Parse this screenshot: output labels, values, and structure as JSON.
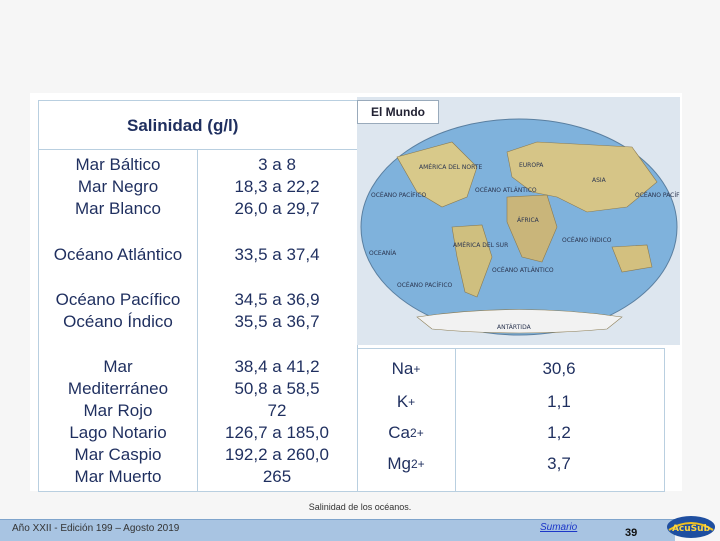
{
  "title": "Salinidad (g/l)",
  "map_title": "El Mundo",
  "map_labels": [
    "AMÉRICA DEL NORTE",
    "EUROPA",
    "ASIA",
    "OCÉANO ATLÁNTICO",
    "OCÉANO PACÍFICO",
    "OCÉANO PACÍFICO",
    "ÁFRICA",
    "AMÉRICA DEL SUR",
    "OCÉANO ÍNDICO",
    "OCEANÍA",
    "OCÉANO ATLÁNTICO",
    "OCÉANO PACÍFICO",
    "ANTÁRTIDA"
  ],
  "rows": [
    {
      "names": "Mar Báltico\nMar Negro\nMar Blanco",
      "values": "3 a 8\n18,3 a 22,2\n26,0 a 29,7"
    },
    {
      "names": "Océano Atlántico",
      "values": "33,5 a 37,4"
    },
    {
      "names": "Océano Pacífico\nOcéano Índico",
      "values": "34,5 a 36,9\n35,5 a 36,7"
    },
    {
      "names": "Mar\nMediterráneo\nMar Rojo\nLago Notario\nMar Caspio\nMar Muerto",
      "values": "38,4 a 41,2\n50,8 a 58,5\n72\n126,7 a 185,0\n192,2 a 260,0\n265"
    }
  ],
  "ions": [
    {
      "ion": "Na",
      "charge": "+",
      "value": "30,6"
    },
    {
      "ion": "K",
      "charge": "+",
      "value": "1,1"
    },
    {
      "ion": "Ca",
      "charge": "2+",
      "value": "1,2"
    },
    {
      "ion": "Mg",
      "charge": "2+",
      "value": "3,7"
    }
  ],
  "caption": "Salinidad de los océanos.",
  "footer_left": "Año XXII - Edición 199 – Agosto 2019",
  "footer_link": "Sumario",
  "page_number": "39",
  "logo_text": "AcuSub"
}
